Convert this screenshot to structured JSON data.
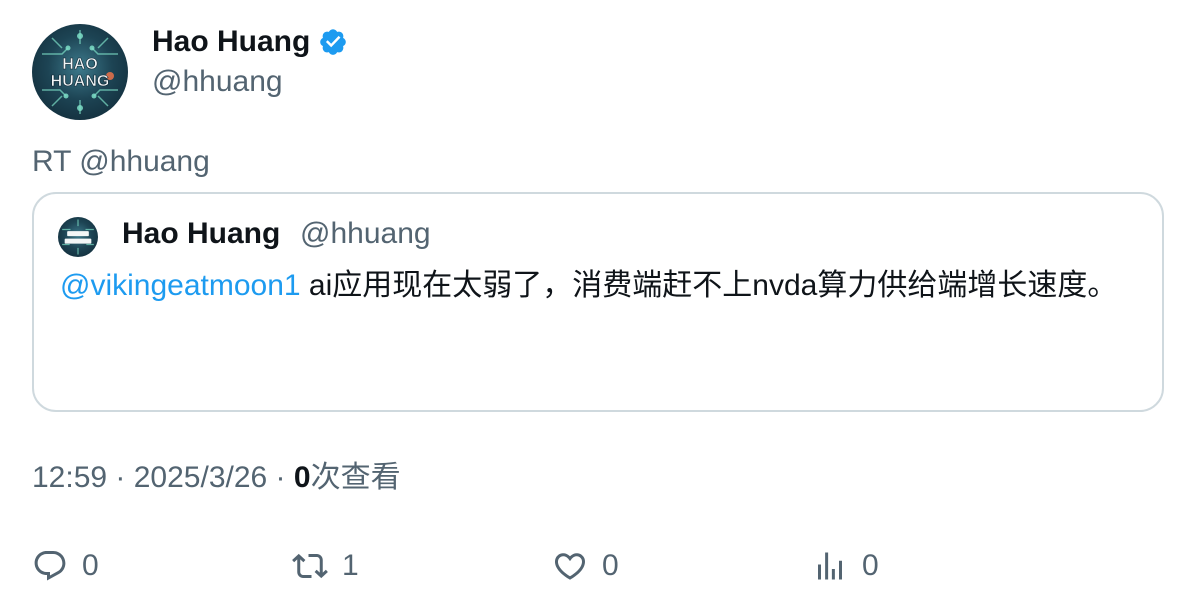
{
  "author": {
    "display_name": "Hao Huang",
    "handle": "@hhuang",
    "avatar_text_top": "HAO",
    "avatar_text_bottom": "HUANG"
  },
  "retweet_text": "RT @hhuang",
  "quoted": {
    "display_name": "Hao Huang",
    "handle": "@hhuang",
    "mention": "@vikingeatmoon1",
    "text": " ai应用现在太弱了，消费端赶不上nvda算力供给端增长速度。"
  },
  "meta": {
    "time": "12:59",
    "separator": " · ",
    "date": "2025/3/26",
    "views_count": "0",
    "views_label": "次查看"
  },
  "actions": {
    "reply_count": "0",
    "retweet_count": "1",
    "like_count": "0",
    "views_count": "0"
  },
  "colors": {
    "verified": "#1d9bf0",
    "mention": "#1d9bf0",
    "secondary_text": "#536471",
    "border": "#cfd9de"
  }
}
